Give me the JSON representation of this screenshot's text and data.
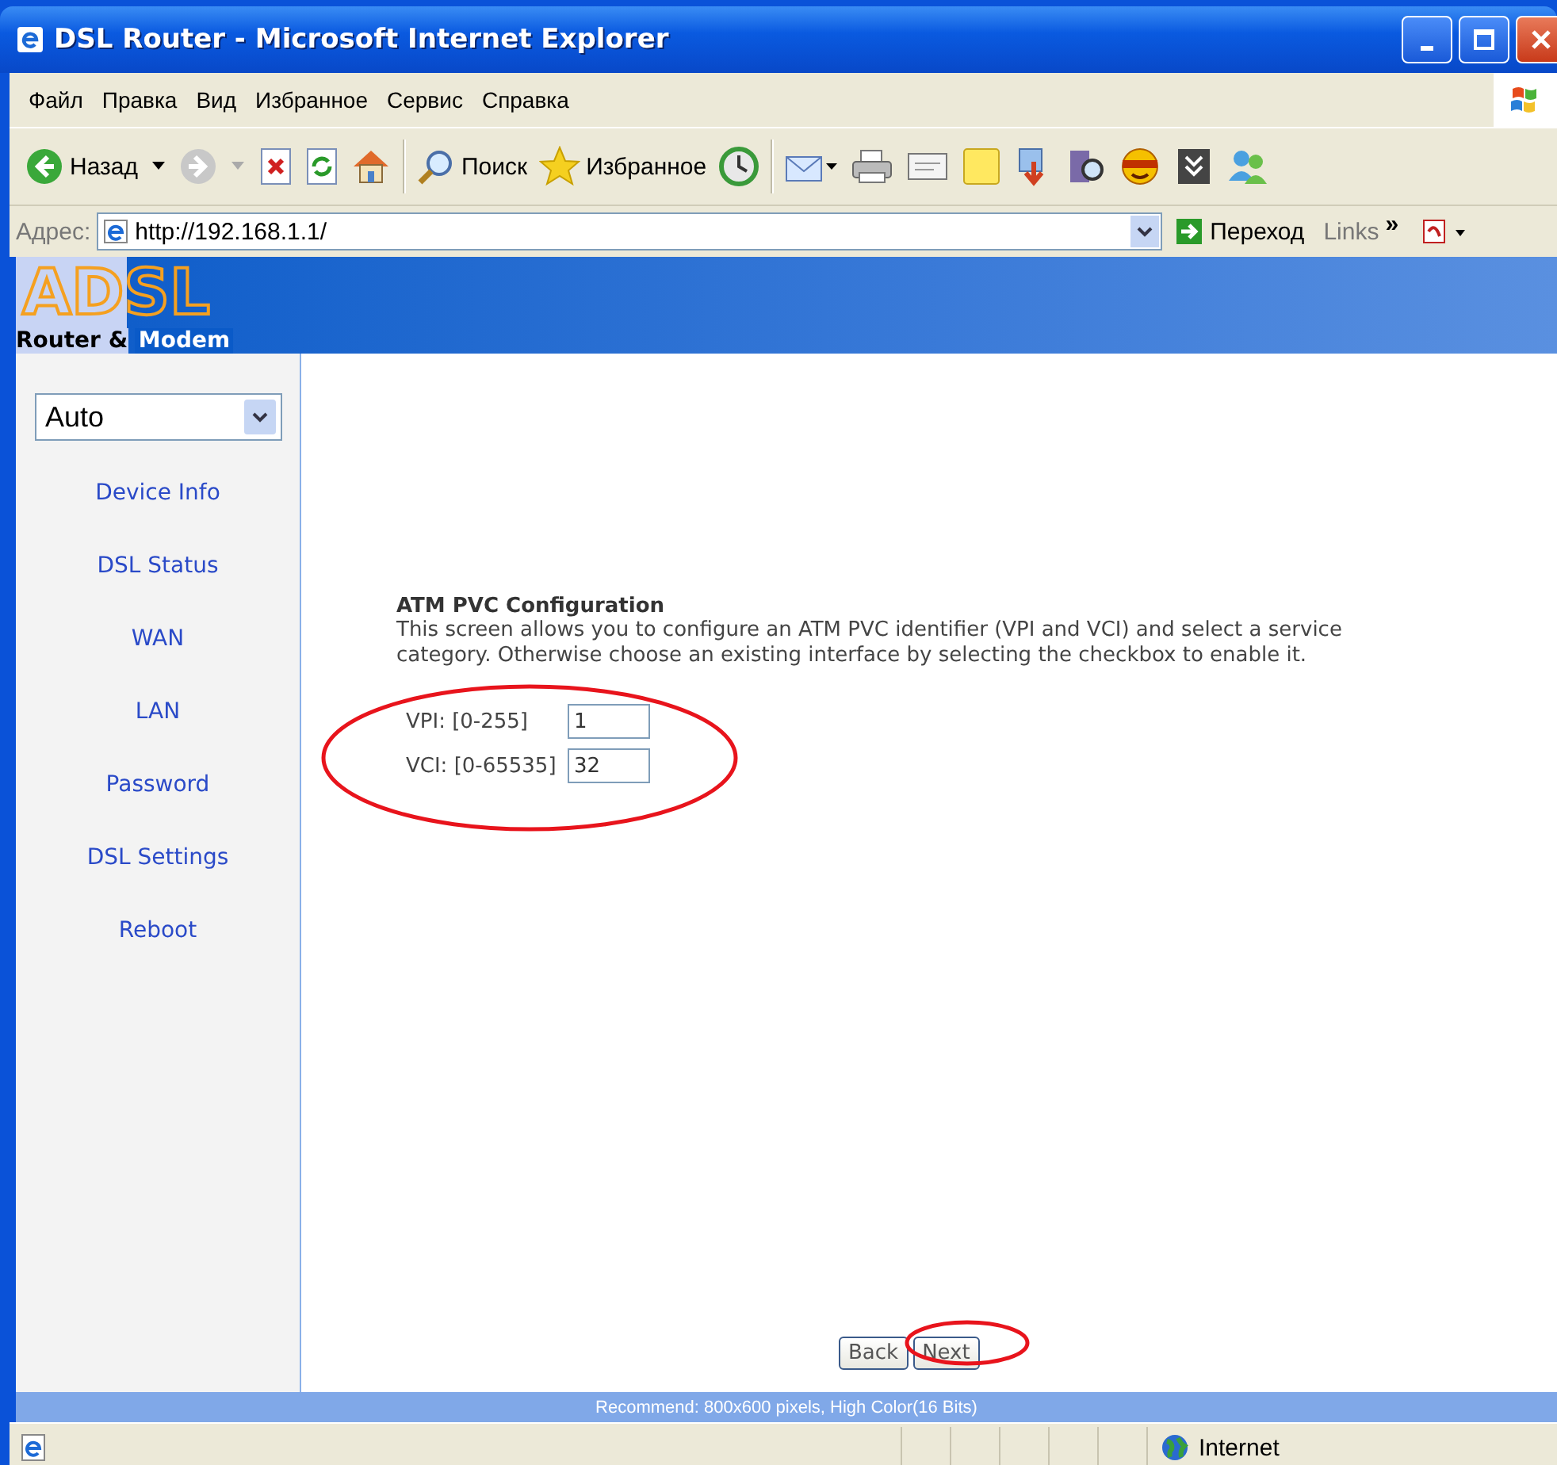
{
  "window": {
    "title": "DSL Router - Microsoft Internet Explorer"
  },
  "menu": [
    "Файл",
    "Правка",
    "Вид",
    "Избранное",
    "Сервис",
    "Справка"
  ],
  "toolbar": {
    "back": "Назад",
    "search": "Поиск",
    "favorites": "Избранное"
  },
  "address_bar": {
    "label": "Адрес:",
    "url": "http://192.168.1.1/",
    "go": "Переход",
    "links": "Links",
    "more": "»"
  },
  "logo": {
    "big": "ADSL",
    "line_1": "Router &",
    "line_2": "Modem"
  },
  "sidebar": {
    "mode": "Auto",
    "items": [
      "Device Info",
      "DSL Status",
      "WAN",
      "LAN",
      "Password",
      "DSL Settings",
      "Reboot"
    ]
  },
  "form": {
    "title": "ATM PVC Configuration",
    "description": "This screen allows you to configure an ATM PVC identifier (VPI and VCI) and select a service category. Otherwise choose an existing interface by selecting the checkbox to enable it.",
    "fields": [
      {
        "label": "VPI: [0-255]",
        "value": "1"
      },
      {
        "label": "VCI: [0-65535]",
        "value": "32"
      }
    ],
    "buttons": [
      "Back",
      "Next"
    ]
  },
  "footer": "Recommend: 800x600 pixels, High Color(16 Bits)",
  "status_bar": {
    "zone": "Internet"
  }
}
